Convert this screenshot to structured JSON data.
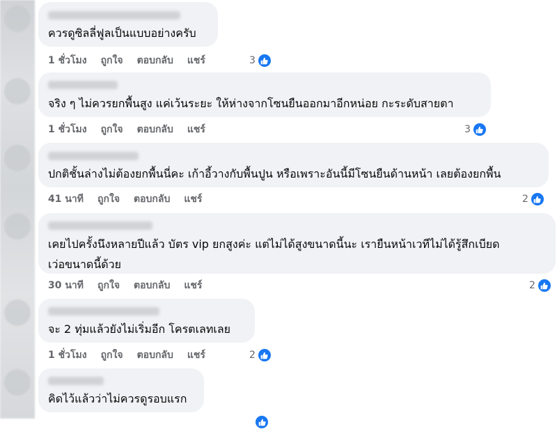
{
  "actions": {
    "like": "ถูกใจ",
    "reply": "ตอบกลับ",
    "share": "แชร์"
  },
  "comments": [
    {
      "text_lines": [
        "ควรดูซิลลี่ฟูลเป็นแบบอย่างครับ"
      ],
      "time": "1 ชั่วโมง",
      "reactions": "3"
    },
    {
      "text_lines": [
        "จริง ๆ ไม่ควรยกพื้นสูง แค่เว้นระยะ ให้ห่างจากโซนยืนออกมาอีกหน่อย กะระดับสายตา"
      ],
      "time": "1 ชั่วโมง",
      "reactions": "3"
    },
    {
      "text_lines": [
        "ปกติชั้นล่างไม่ต้องยกพื้นนี่คะ เก้าอี้วางกับพื้นปูน หรือเพราะอันนี้มีโซนยืนด้านหน้า เลยต้องยกพื้น"
      ],
      "time": "41 นาที",
      "reactions": "2"
    },
    {
      "text_lines": [
        "เคยไปครั้งนึงหลายปีแล้ว บัตร vip ยกสูงค่ะ แต่ไม่ได้สูงขนาดนี้นะ เรายืนหน้าเวทีไม่ได้รู้สึกเบียด",
        "เว่อขนาดนี้ด้วย"
      ],
      "time": "30 นาที",
      "reactions": "2"
    },
    {
      "text_lines": [
        "จะ 2 ทุ่มแล้วยังไม่เริ่มอีก โครตเลทเลย"
      ],
      "time": "1 ชั่วโมง",
      "reactions": "2"
    },
    {
      "text_lines": [
        "คิดไว้แล้วว่าไม่ควรดูรอบแรก"
      ],
      "time": "",
      "reactions": ""
    }
  ],
  "colors": {
    "bubble": "#f0f2f5",
    "like_blue": "#1877f2",
    "meta_gray": "#65676b"
  },
  "icons": {
    "reaction": "thumbs-up-icon"
  }
}
